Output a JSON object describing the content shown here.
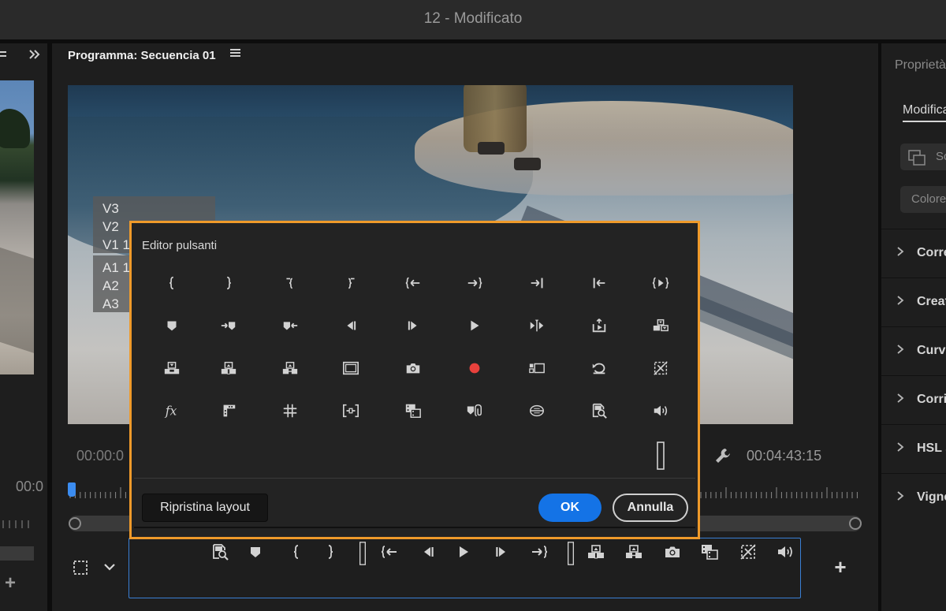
{
  "window": {
    "title": "12 - Modificato"
  },
  "program_monitor": {
    "title": "Programma: Secuencia 01",
    "timecode_in": "00:00:0",
    "timecode_duration": "00:04:43:15",
    "tracks": [
      "V3",
      "V2",
      "V1",
      "A1",
      "A2",
      "A3"
    ],
    "track_suffix_v1": "1",
    "track_suffix_a1": "1"
  },
  "left_panel": {
    "timecode": "00:0"
  },
  "right_panel": {
    "title": "Proprietà",
    "tab": "Modifica",
    "button1": "Sc",
    "button2": "Colore",
    "sections": [
      "Corre",
      "Creat",
      "Curve",
      "Corri",
      "HSL s",
      "Vigne"
    ]
  },
  "dialog": {
    "title": "Editor pulsanti",
    "reset_label": "Ripristina layout",
    "ok_label": "OK",
    "cancel_label": "Annulla",
    "icons": [
      "mark-in-icon",
      "mark-out-icon",
      "mark-clip-in-icon",
      "mark-clip-out-icon",
      "go-to-in-icon",
      "go-to-out-icon",
      "go-to-out-point-icon",
      "go-to-in-point-icon",
      "play-in-to-out-icon",
      "add-marker-icon",
      "go-to-next-marker-icon",
      "go-to-previous-marker-icon",
      "step-back-icon",
      "step-forward-icon",
      "play-icon",
      "play-around-icon",
      "export-frame-icon",
      "overwrite-icon",
      "insert-icon",
      "lift-icon",
      "extract-icon",
      "safe-margins-icon",
      "camera-icon",
      "record-icon",
      "multicam-icon",
      "undo-icon",
      "proxy-toggle-icon",
      "fx-icon",
      "timecode-overlay-icon",
      "grid-icon",
      "trim-icon",
      "comparison-view-icon",
      "link-marker-icon",
      "vr-icon",
      "zoom-search-icon",
      "volume-icon",
      "spacer-icon"
    ]
  },
  "toolbar": {
    "icons": [
      "zoom-search-icon",
      "add-marker-icon",
      "mark-in-icon",
      "mark-out-icon",
      "spacer-icon",
      "go-to-in-icon",
      "step-back-icon",
      "play-icon",
      "step-forward-icon",
      "go-to-out-icon",
      "spacer-icon",
      "lift-icon",
      "extract-icon",
      "camera-icon",
      "comparison-view-icon",
      "proxy-toggle-icon",
      "volume-icon"
    ]
  },
  "colors": {
    "accent": "#1473e6",
    "dialog_border": "#ef9a2a",
    "record": "#e8413c",
    "toolbar_border": "#3a7fd4"
  }
}
